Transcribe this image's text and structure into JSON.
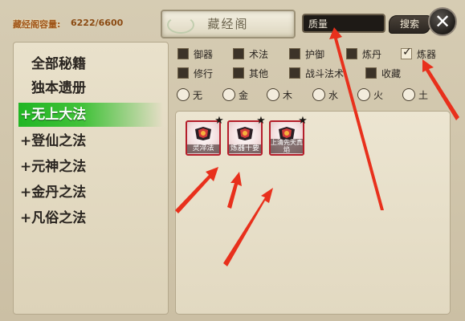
{
  "header": {
    "capacity_label": "藏经阁容量:",
    "capacity_value": "6222/6600",
    "title": "藏经阁"
  },
  "search": {
    "value": "质量",
    "button_label": "搜索",
    "close_glyph": "✕"
  },
  "categories": [
    {
      "label": "全部秘籍",
      "active": false
    },
    {
      "label": "独本遗册",
      "active": false
    },
    {
      "label": "+无上大法",
      "active": true
    },
    {
      "label": "+登仙之法",
      "active": false
    },
    {
      "label": "+元神之法",
      "active": false
    },
    {
      "label": "+金丹之法",
      "active": false
    },
    {
      "label": "+凡俗之法",
      "active": false
    }
  ],
  "filters": {
    "row1": [
      {
        "label": "御器",
        "checked": false
      },
      {
        "label": "术法",
        "checked": false
      },
      {
        "label": "护御",
        "checked": false
      },
      {
        "label": "炼丹",
        "checked": false
      },
      {
        "label": "炼器",
        "checked": true
      }
    ],
    "row2": [
      {
        "label": "修行",
        "checked": false
      },
      {
        "label": "其他",
        "checked": false
      },
      {
        "label": "战斗法术",
        "checked": false
      },
      {
        "label": "收藏",
        "checked": false
      }
    ]
  },
  "elements": [
    {
      "label": "无"
    },
    {
      "label": "金"
    },
    {
      "label": "木"
    },
    {
      "label": "水"
    },
    {
      "label": "火"
    },
    {
      "label": "土"
    }
  ],
  "items": [
    {
      "label": "灵淬法",
      "star": "★"
    },
    {
      "label": "炼器十要",
      "star": "★"
    },
    {
      "label": "上清先天真焰",
      "star": "★"
    }
  ],
  "colors": {
    "active_category": "#2bb52a",
    "annotation_arrow": "#e8301c",
    "item_border": "#b41e2a"
  }
}
